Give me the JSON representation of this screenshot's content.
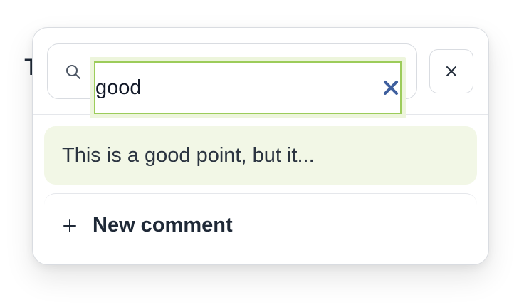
{
  "background": {
    "partial_text": "T"
  },
  "popover": {
    "search": {
      "value": "good",
      "icon": "search-icon",
      "clear_icon": "clear-x-icon"
    },
    "close_button": {
      "icon": "close-icon"
    },
    "results": [
      {
        "text": "This is a good point, but it..."
      }
    ],
    "new_comment": {
      "icon": "plus-icon",
      "label": "New comment"
    }
  },
  "colors": {
    "highlight_bg": "#f2f7e6",
    "focus_border": "#9ccc5a",
    "clear_icon": "#3f5f9e"
  }
}
